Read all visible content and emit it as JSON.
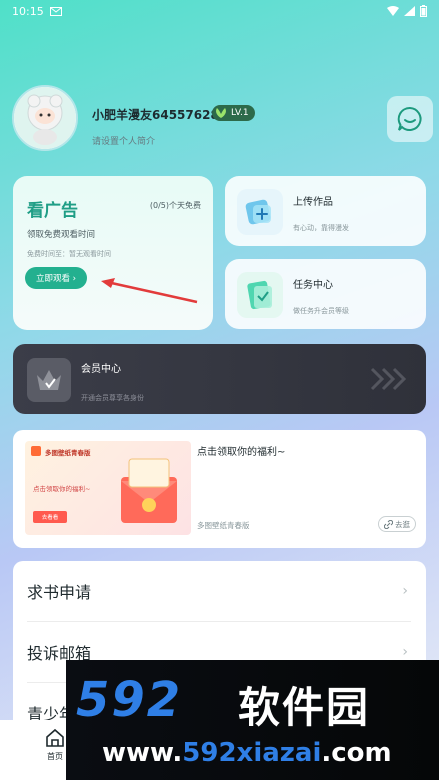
{
  "status_bar": {
    "time": "10:15",
    "mail_icon": "mail-icon",
    "wifi_icon": "wifi-icon",
    "signal_icon": "signal-icon",
    "battery_icon": "battery-icon"
  },
  "profile": {
    "avatar_icon": "sheep-avatar",
    "avatar_text": "小肥羊",
    "nickname": "小肥羊漫友64557628",
    "level": "LV.1",
    "bio_placeholder": "请设置个人简介",
    "chat_icon": "chat-bubble-icon"
  },
  "ad_card": {
    "title": "看广告",
    "count": "(0/5)个天免费",
    "subtitle": "领取免费观看时间",
    "free_time": "免费时间至：暂无观看时间",
    "button": "立即观看 ›"
  },
  "upload_card": {
    "title": "上传作品",
    "desc": "有心动，靠得漫发",
    "icon": "upload-work-icon"
  },
  "task_card": {
    "title": "任务中心",
    "desc": "做任务升会员等级",
    "icon": "task-center-icon"
  },
  "vip_card": {
    "title": "会员中心",
    "desc": "开通会员尊享各身份",
    "icon": "crown-icon"
  },
  "banner": {
    "brand": "多图壁纸青春版",
    "inner_text": "点击领取你的福利~",
    "inner_button": "去看看",
    "title": "点击领取你的福利~",
    "source": "多图壁纸青春版",
    "link": "去逛"
  },
  "menu": {
    "items": [
      {
        "label": "求书申请"
      },
      {
        "label": "投诉邮箱"
      },
      {
        "label": "青少年"
      }
    ]
  },
  "bottom_nav": {
    "home_label": "首页",
    "home_icon": "home-icon"
  },
  "watermark": {
    "logo": "592",
    "name": "软件园",
    "url_prefix": "www.",
    "url_domain": "592xiazai",
    "url_suffix": ".com"
  },
  "colors": {
    "accent": "#23b08f",
    "vip_bg": "#3b3d48",
    "watermark_blue": "#2f7fe6"
  }
}
